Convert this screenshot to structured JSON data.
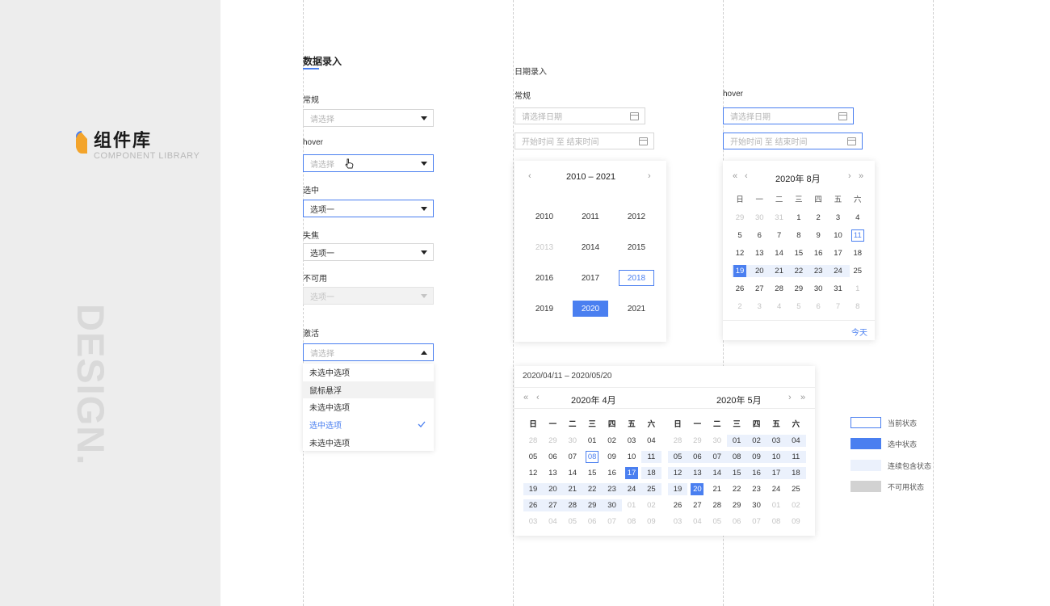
{
  "brand": {
    "title": "组件库",
    "subtitle": "COMPONENT LIBRARY",
    "watermark": "DESIGN."
  },
  "colors": {
    "accent": "#4a7ff0",
    "range": "#ebf1fc",
    "disabled": "#d2d2d2"
  },
  "data_entry": {
    "title": "数据录入",
    "normal": {
      "label": "常规",
      "placeholder": "请选择"
    },
    "hover": {
      "label": "hover",
      "placeholder": "请选择"
    },
    "selected": {
      "label": "选中",
      "value": "选项一"
    },
    "blurred": {
      "label": "失焦",
      "value": "选项一"
    },
    "disabled": {
      "label": "不可用",
      "value": "选项一"
    },
    "active": {
      "label": "激活",
      "placeholder": "请选择",
      "options": [
        "未选中选项",
        "鼠标悬浮",
        "未选中选项",
        "选中选项",
        "未选中选项"
      ]
    }
  },
  "date_entry": {
    "title": "日期录入",
    "normal_label": "常规",
    "hover_label": "hover",
    "date_placeholder": "请选择日期",
    "range_placeholder": "开始时间 至 结束时间"
  },
  "year_picker": {
    "header": "2010 – 2021",
    "years": [
      "2010",
      "2011",
      "2012",
      "2013",
      "2014",
      "2015",
      "2016",
      "2017",
      "2018",
      "2019",
      "2020",
      "2021"
    ]
  },
  "month_picker": {
    "header": "2020年 8月",
    "weekdays": [
      "日",
      "一",
      "二",
      "三",
      "四",
      "五",
      "六"
    ],
    "days": [
      "29",
      "30",
      "31",
      "1",
      "2",
      "3",
      "4",
      "5",
      "6",
      "7",
      "8",
      "9",
      "10",
      "11",
      "12",
      "13",
      "14",
      "15",
      "16",
      "17",
      "18",
      "19",
      "20",
      "21",
      "22",
      "23",
      "24",
      "25",
      "26",
      "27",
      "28",
      "29",
      "30",
      "31",
      "1",
      "2",
      "3",
      "4",
      "5",
      "6",
      "7",
      "8"
    ],
    "today": "今天"
  },
  "range_picker": {
    "range_text": "2020/04/11 – 2020/05/20",
    "left": {
      "header": "2020年 4月",
      "days": [
        "28",
        "29",
        "30",
        "01",
        "02",
        "03",
        "04",
        "05",
        "06",
        "07",
        "08",
        "09",
        "10",
        "11",
        "12",
        "13",
        "14",
        "15",
        "16",
        "17",
        "18",
        "19",
        "20",
        "21",
        "22",
        "23",
        "24",
        "25",
        "26",
        "27",
        "28",
        "29",
        "30",
        "01",
        "02",
        "03",
        "04",
        "05",
        "06",
        "07",
        "08",
        "09"
      ]
    },
    "right": {
      "header": "2020年 5月",
      "days": [
        "28",
        "29",
        "30",
        "01",
        "02",
        "03",
        "04",
        "05",
        "06",
        "07",
        "08",
        "09",
        "10",
        "11",
        "12",
        "13",
        "14",
        "15",
        "16",
        "17",
        "18",
        "19",
        "20",
        "21",
        "22",
        "23",
        "24",
        "25",
        "26",
        "27",
        "28",
        "29",
        "30",
        "01",
        "02",
        "03",
        "04",
        "05",
        "06",
        "07",
        "08",
        "09"
      ]
    }
  },
  "legend": [
    "当前状态",
    "选中状态",
    "连续包含状态",
    "不可用状态"
  ]
}
